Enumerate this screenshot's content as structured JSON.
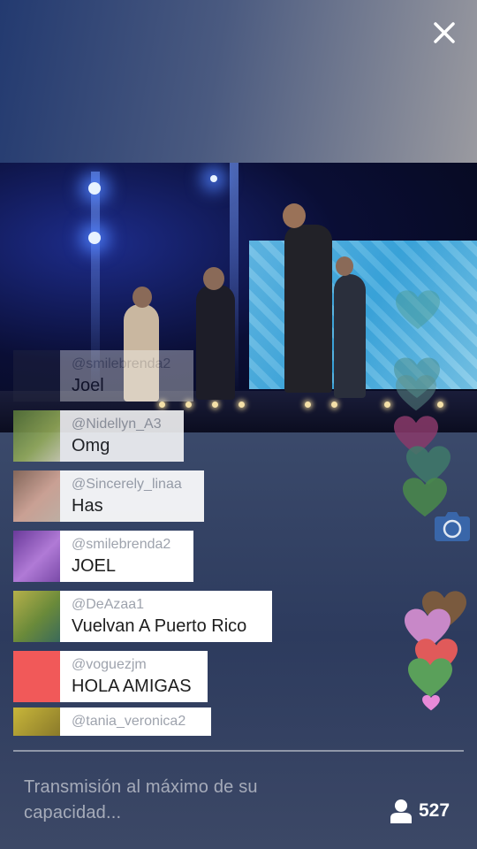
{
  "header": {
    "close_icon": "close-icon (×)"
  },
  "comments": [
    {
      "user": "@smilebrenda2",
      "message": "Joel",
      "avatar_color": "#2a2d42",
      "faded": true
    },
    {
      "user": "@Nidellyn_A3",
      "message": "Omg",
      "avatar_color": "#7aa04a"
    },
    {
      "user": "@Sincerely_linaa",
      "message": "Has",
      "avatar_color": "#b98a7a"
    },
    {
      "user": "@smilebrenda2",
      "message": "JOEL",
      "avatar_color": "#8a4fb3"
    },
    {
      "user": "@DeAzaa1",
      "message": "Vuelvan A Puerto Rico",
      "avatar_color": "#8fa23e"
    },
    {
      "user": "@voguezjm",
      "message": "HOLA AMIGAS",
      "avatar_color": "#f15959"
    },
    {
      "user": "@tania_veronica2",
      "message": "",
      "avatar_color": "#c8b63a"
    }
  ],
  "hearts": {
    "colors": [
      "#4a8e8e",
      "#4a9a8e",
      "#5e8f8a",
      "#8a3a6a",
      "#3f7a6a",
      "#4a8a4a",
      "#7a5a3e",
      "#c888c8",
      "#e05a5a",
      "#5aa05a",
      "#e88ad8"
    ]
  },
  "camera_button": {
    "icon": "camera-icon",
    "color": "#3a6ab0"
  },
  "footer": {
    "status": "Transmisión al máximo de su capacidad...",
    "viewer_icon": "person-icon",
    "viewer_count": "527"
  }
}
